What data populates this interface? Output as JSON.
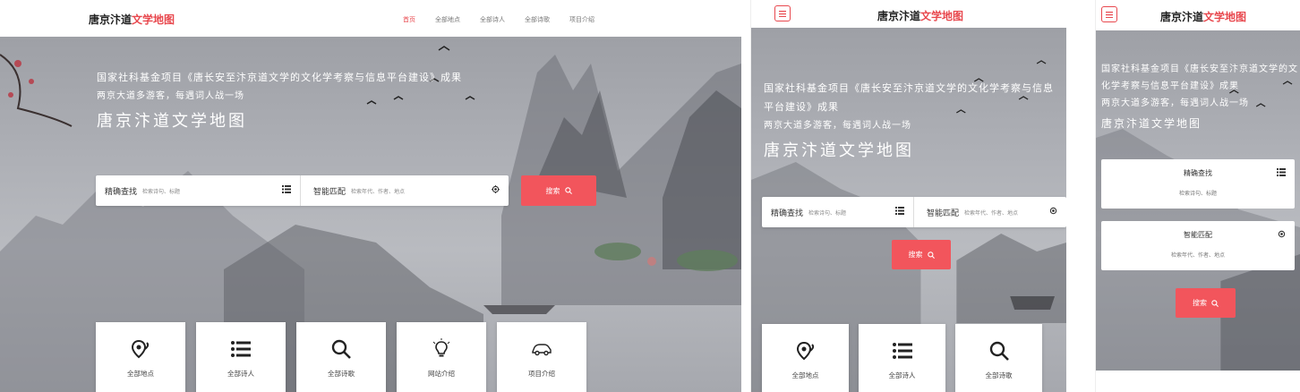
{
  "brand": {
    "main": "唐京汴道",
    "accent": "文学地图"
  },
  "nav": [
    "首页",
    "全部地点",
    "全部诗人",
    "全部诗歌",
    "项目介绍"
  ],
  "hero": {
    "line1": "国家社科基金项目《唐长安至汴京道文学的文化学考察与信息平台建设》成果",
    "line1_part_a": "国家社科基金项目《唐长安至汴京道文学的文化学考察与信息",
    "line1_part_b": "平台建设》成果",
    "line1_mobile_a": "国家社科基金项目《唐长安至汴京道文学的文",
    "line1_mobile_b": "化学考察与信息平台建设》成果",
    "line2": "两京大道多游客，每遇词人战一场",
    "title": "唐京汴道文学地图"
  },
  "search": {
    "exact_title": "精确查找",
    "exact_hint": "检索诗句、标题",
    "smart_title": "智能匹配",
    "smart_hint": "检索年代、作者、地点",
    "button": "搜索"
  },
  "tiles": [
    "全部地点",
    "全部诗人",
    "全部诗歌",
    "网站介绍",
    "项目介绍"
  ],
  "colors": {
    "accent": "#e8484e",
    "button": "#f2555c"
  },
  "icons": [
    "map-pin-icon",
    "list-icon",
    "search-icon",
    "lightbulb-icon",
    "car-icon",
    "target-icon",
    "menu-icon"
  ]
}
